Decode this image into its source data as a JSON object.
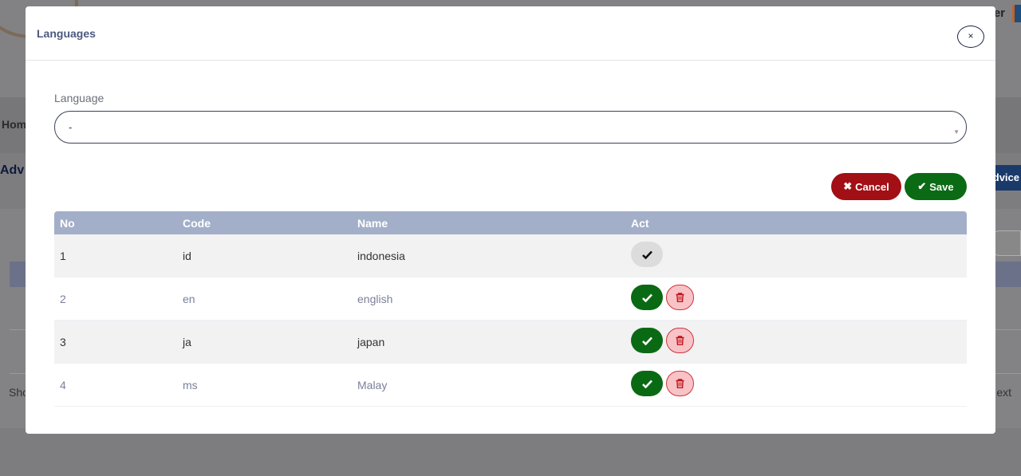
{
  "background": {
    "user_text": "er",
    "nav_home": "Hom",
    "heading": "Adv",
    "advice_button": "dvice",
    "pager_show": "Sho",
    "pager_next": "ext"
  },
  "modal": {
    "title": "Languages",
    "close_label": "×",
    "field_label": "Language",
    "select_value": "-",
    "cancel_label": "Cancel",
    "save_label": "Save"
  },
  "table": {
    "headers": [
      "No",
      "Code",
      "Name",
      "Act"
    ],
    "rows": [
      {
        "no": "1",
        "code": "id",
        "name": "indonesia",
        "active": true
      },
      {
        "no": "2",
        "code": "en",
        "name": "english",
        "active": false
      },
      {
        "no": "3",
        "code": "ja",
        "name": "japan",
        "active": false
      },
      {
        "no": "4",
        "code": "ms",
        "name": "Malay",
        "active": false
      }
    ]
  },
  "colors": {
    "cancel": "#a20f14",
    "save": "#0b6a14",
    "table_header": "#a3afc9",
    "delete_bg": "#f8c3c6"
  }
}
